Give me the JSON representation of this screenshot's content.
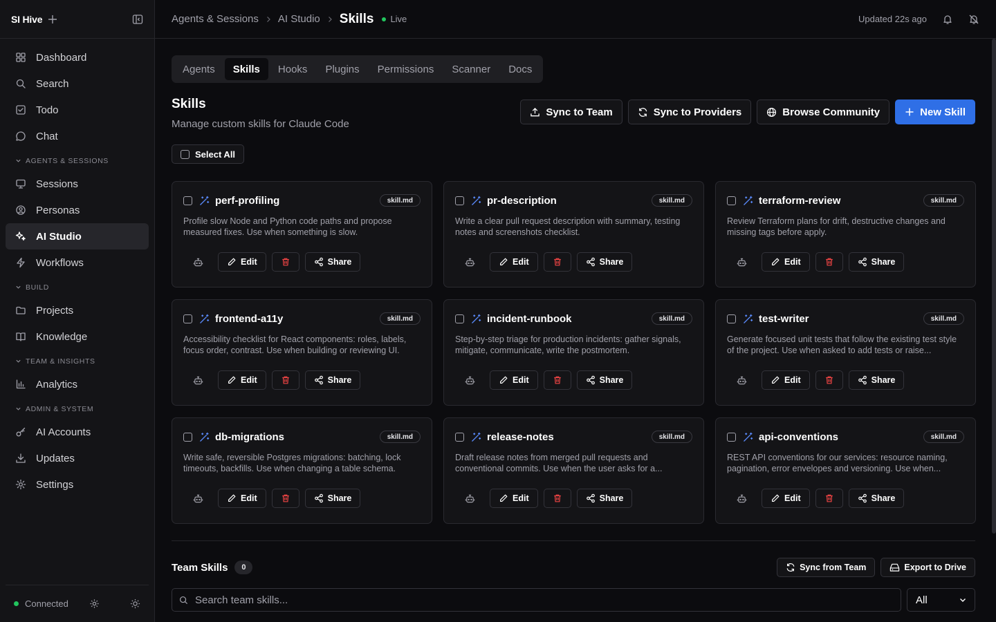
{
  "app": {
    "title": "SI Hive"
  },
  "sidebar": {
    "top_items": [
      {
        "label": "Dashboard",
        "icon": "dashboard-icon"
      },
      {
        "label": "Search",
        "icon": "search-icon"
      },
      {
        "label": "Todo",
        "icon": "todo-icon"
      },
      {
        "label": "Chat",
        "icon": "chat-icon"
      }
    ],
    "sections": [
      {
        "label": "AGENTS & SESSIONS",
        "items": [
          {
            "label": "Sessions",
            "icon": "monitor-icon"
          },
          {
            "label": "Personas",
            "icon": "persona-icon"
          },
          {
            "label": "AI Studio",
            "icon": "sparkles-icon",
            "active": true
          },
          {
            "label": "Workflows",
            "icon": "zap-icon"
          }
        ]
      },
      {
        "label": "BUILD",
        "items": [
          {
            "label": "Projects",
            "icon": "folder-icon"
          },
          {
            "label": "Knowledge",
            "icon": "book-icon"
          }
        ]
      },
      {
        "label": "TEAM & INSIGHTS",
        "items": [
          {
            "label": "Analytics",
            "icon": "bar-chart-icon"
          }
        ]
      },
      {
        "label": "ADMIN & SYSTEM",
        "items": [
          {
            "label": "AI Accounts",
            "icon": "key-icon"
          },
          {
            "label": "Updates",
            "icon": "download-icon"
          },
          {
            "label": "Settings",
            "icon": "gear-icon"
          }
        ]
      }
    ],
    "footer": {
      "status": "Connected",
      "status_color": "#22c55e"
    }
  },
  "topbar": {
    "breadcrumb": [
      "Agents & Sessions",
      "AI Studio"
    ],
    "current": "Skills",
    "live": "Live",
    "updated": "Updated 22s ago"
  },
  "tabs": [
    "Agents",
    "Skills",
    "Hooks",
    "Plugins",
    "Permissions",
    "Scanner",
    "Docs"
  ],
  "active_tab": "Skills",
  "page": {
    "title": "Skills",
    "subtitle": "Manage custom skills for Claude Code",
    "actions": {
      "sync_team": "Sync to Team",
      "sync_providers": "Sync to Providers",
      "browse": "Browse Community",
      "new_skill": "New Skill"
    },
    "select_all": "Select All"
  },
  "skills": [
    {
      "name": "perf-profiling",
      "badge": "skill.md",
      "desc": "Profile slow Node and Python code paths and propose measured fixes. Use when something is slow."
    },
    {
      "name": "pr-description",
      "badge": "skill.md",
      "desc": "Write a clear pull request description with summary, testing notes and screenshots checklist."
    },
    {
      "name": "terraform-review",
      "badge": "skill.md",
      "desc": "Review Terraform plans for drift, destructive changes and missing tags before apply."
    },
    {
      "name": "frontend-a11y",
      "badge": "skill.md",
      "desc": "Accessibility checklist for React components: roles, labels, focus order, contrast. Use when building or reviewing UI."
    },
    {
      "name": "incident-runbook",
      "badge": "skill.md",
      "desc": "Step-by-step triage for production incidents: gather signals, mitigate, communicate, write the postmortem."
    },
    {
      "name": "test-writer",
      "badge": "skill.md",
      "desc": "Generate focused unit tests that follow the existing test style of the project. Use when asked to add tests or raise..."
    },
    {
      "name": "db-migrations",
      "badge": "skill.md",
      "desc": "Write safe, reversible Postgres migrations: batching, lock timeouts, backfills. Use when changing a table schema."
    },
    {
      "name": "release-notes",
      "badge": "skill.md",
      "desc": "Draft release notes from merged pull requests and conventional commits. Use when the user asks for a..."
    },
    {
      "name": "api-conventions",
      "badge": "skill.md",
      "desc": "REST API conventions for our services: resource naming, pagination, error envelopes and versioning. Use when..."
    }
  ],
  "card_labels": {
    "edit": "Edit",
    "share": "Share"
  },
  "team": {
    "title": "Team Skills",
    "count": "0",
    "sync_from": "Sync from Team",
    "export": "Export to Drive",
    "search_placeholder": "Search team skills...",
    "filter": "All"
  },
  "colors": {
    "accent": "#2f6fe6",
    "danger": "#ef4444",
    "wand": "#5b8cff"
  }
}
